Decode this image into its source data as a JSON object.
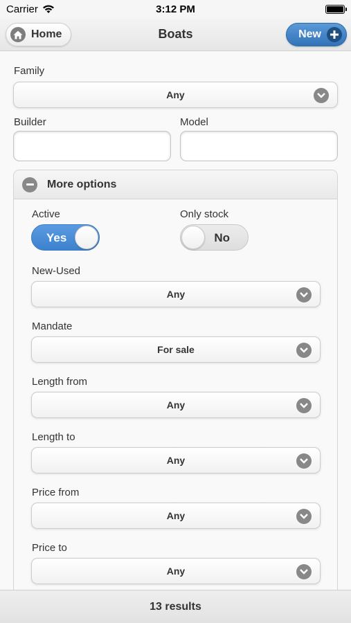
{
  "status_bar": {
    "carrier": "Carrier",
    "time": "3:12 PM"
  },
  "header": {
    "title": "Boats",
    "home_label": "Home",
    "new_label": "New"
  },
  "form": {
    "family": {
      "label": "Family",
      "value": "Any"
    },
    "builder": {
      "label": "Builder",
      "value": ""
    },
    "model": {
      "label": "Model",
      "value": ""
    },
    "more_options": {
      "label": "More options",
      "active": {
        "label": "Active",
        "value": "Yes"
      },
      "only_stock": {
        "label": "Only stock",
        "value": "No"
      },
      "new_used": {
        "label": "New-Used",
        "value": "Any"
      },
      "mandate": {
        "label": "Mandate",
        "value": "For sale"
      },
      "length_from": {
        "label": "Length from",
        "value": "Any"
      },
      "length_to": {
        "label": "Length to",
        "value": "Any"
      },
      "price_from": {
        "label": "Price from",
        "value": "Any"
      },
      "price_to": {
        "label": "Price to",
        "value": "Any"
      }
    }
  },
  "footer": {
    "results": "13 results"
  },
  "icons": {
    "home": "home-icon",
    "new": "plus-icon",
    "collapse": "minus-icon",
    "dropdown": "chevron-down-icon",
    "wifi": "wifi-icon",
    "battery": "battery-icon"
  },
  "colors": {
    "accent": "#3d82cf",
    "icon_gray": "#888888"
  }
}
